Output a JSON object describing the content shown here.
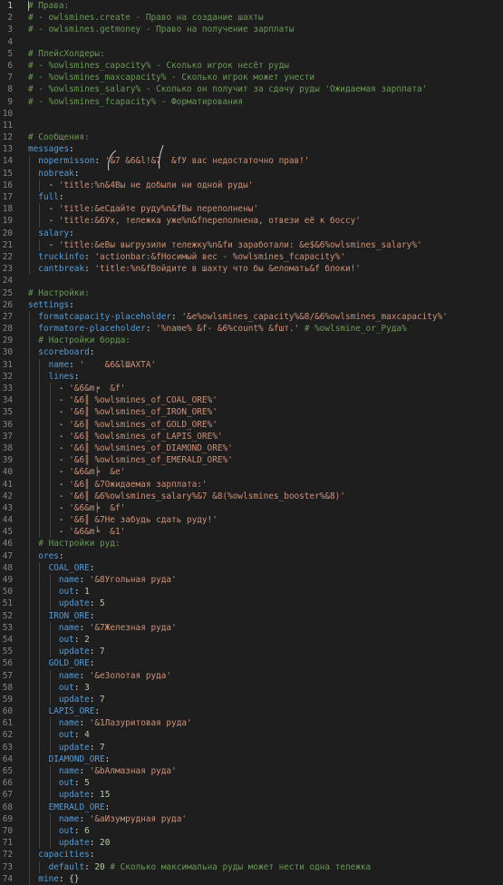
{
  "editor": {
    "lines": [
      {
        "n": "1",
        "t": [
          [
            "c",
            "# Права:"
          ]
        ]
      },
      {
        "n": "2",
        "t": [
          [
            "c",
            "# - owlsmines.create - Право на создание шахты"
          ]
        ]
      },
      {
        "n": "3",
        "t": [
          [
            "c",
            "# - owlsmines.getmoney - Право на получение зарплаты"
          ]
        ]
      },
      {
        "n": "4",
        "t": []
      },
      {
        "n": "5",
        "t": [
          [
            "c",
            "# ПлейсХолдеры:"
          ]
        ]
      },
      {
        "n": "6",
        "t": [
          [
            "c",
            "# - %owlsmines_capacity% - Сколько игрок несёт руды"
          ]
        ]
      },
      {
        "n": "7",
        "t": [
          [
            "c",
            "# - %owlsmines_maxcapacity% - Сколько игрок может унести"
          ]
        ]
      },
      {
        "n": "8",
        "t": [
          [
            "c",
            "# - %owlsmines_salary% - Сколько он получит за сдачу руды 'Ожидаемая зарплата'"
          ]
        ]
      },
      {
        "n": "9",
        "t": [
          [
            "c",
            "# - %owlsmines_fcapacity% - Форматирования"
          ]
        ]
      },
      {
        "n": "10",
        "t": []
      },
      {
        "n": "11",
        "t": []
      },
      {
        "n": "12",
        "t": [
          [
            "c",
            "# Сообщения:"
          ]
        ]
      },
      {
        "n": "13",
        "t": [
          [
            "k",
            "messages"
          ],
          [
            "p",
            ":"
          ]
        ]
      },
      {
        "n": "14",
        "t": [
          [
            "p",
            "  "
          ],
          [
            "k",
            "nopermisson"
          ],
          [
            "p",
            ": "
          ],
          [
            "s",
            "'&7 &6&l!&7  &fУ вас недостаточно прав!'"
          ]
        ]
      },
      {
        "n": "15",
        "t": [
          [
            "p",
            "  "
          ],
          [
            "k",
            "nobreak"
          ],
          [
            "p",
            ":"
          ]
        ]
      },
      {
        "n": "16",
        "t": [
          [
            "p",
            "    - "
          ],
          [
            "s",
            "'title:%n&4Вы не добыли ни одной руды'"
          ]
        ]
      },
      {
        "n": "17",
        "t": [
          [
            "p",
            "  "
          ],
          [
            "k",
            "full"
          ],
          [
            "p",
            ":"
          ]
        ]
      },
      {
        "n": "18",
        "t": [
          [
            "p",
            "    - "
          ],
          [
            "s",
            "'title:&eСдайте руду%n&fВы переполнены'"
          ]
        ]
      },
      {
        "n": "19",
        "t": [
          [
            "p",
            "    - "
          ],
          [
            "s",
            "'title:&6Ух, тележка уже%n&fпереполнена, отвези её к боссу'"
          ]
        ]
      },
      {
        "n": "20",
        "t": [
          [
            "p",
            "  "
          ],
          [
            "k",
            "salary"
          ],
          [
            "p",
            ":"
          ]
        ]
      },
      {
        "n": "21",
        "t": [
          [
            "p",
            "    - "
          ],
          [
            "s",
            "'title:&eВы выгрузили тележку%n&fи заработали: &e$&6%owlsmines_salary%'"
          ]
        ]
      },
      {
        "n": "22",
        "t": [
          [
            "p",
            "  "
          ],
          [
            "k",
            "truckinfo"
          ],
          [
            "p",
            ": "
          ],
          [
            "s",
            "'actionbar:&fНосимый вес - %owlsmines_fcapacity%'"
          ]
        ]
      },
      {
        "n": "23",
        "t": [
          [
            "p",
            "  "
          ],
          [
            "k",
            "cantbreak"
          ],
          [
            "p",
            ": "
          ],
          [
            "s",
            "'title:%n&fВойдите в шахту что бы &eломать&f блоки!'"
          ]
        ]
      },
      {
        "n": "24",
        "t": []
      },
      {
        "n": "25",
        "t": [
          [
            "c",
            "# Настройки:"
          ]
        ]
      },
      {
        "n": "26",
        "t": [
          [
            "k",
            "settings"
          ],
          [
            "p",
            ":"
          ]
        ]
      },
      {
        "n": "27",
        "t": [
          [
            "p",
            "  "
          ],
          [
            "k",
            "formatcapacity-placeholder"
          ],
          [
            "p",
            ": "
          ],
          [
            "s",
            "'&e%owlsmines_capacity%&8/&6%owlsmines_maxcapacity%'"
          ]
        ]
      },
      {
        "n": "28",
        "t": [
          [
            "p",
            "  "
          ],
          [
            "k",
            "formatore-placeholder"
          ],
          [
            "p",
            ": "
          ],
          [
            "s",
            "'%name% &f- &6%count% &fшт.'"
          ],
          [
            "p",
            " "
          ],
          [
            "c",
            "# %owlsmine_or_Руда%"
          ]
        ]
      },
      {
        "n": "29",
        "t": [
          [
            "p",
            "  "
          ],
          [
            "c",
            "# Настройки борда:"
          ]
        ]
      },
      {
        "n": "30",
        "t": [
          [
            "p",
            "  "
          ],
          [
            "k",
            "scoreboard"
          ],
          [
            "p",
            ":"
          ]
        ]
      },
      {
        "n": "31",
        "t": [
          [
            "p",
            "    "
          ],
          [
            "k",
            "name"
          ],
          [
            "p",
            ": "
          ],
          [
            "s",
            "'    &6&lШАХТА'"
          ]
        ]
      },
      {
        "n": "32",
        "t": [
          [
            "p",
            "    "
          ],
          [
            "k",
            "lines"
          ],
          [
            "p",
            ":"
          ]
        ]
      },
      {
        "n": "33",
        "t": [
          [
            "p",
            "      - "
          ],
          [
            "s",
            "'&6&m╒  &f'"
          ]
        ]
      },
      {
        "n": "34",
        "t": [
          [
            "p",
            "      - "
          ],
          [
            "s",
            "'&6║ %owlsmines_of_COAL_ORE%'"
          ]
        ]
      },
      {
        "n": "35",
        "t": [
          [
            "p",
            "      - "
          ],
          [
            "s",
            "'&6║ %owlsmines_of_IRON_ORE%'"
          ]
        ]
      },
      {
        "n": "36",
        "t": [
          [
            "p",
            "      - "
          ],
          [
            "s",
            "'&6║ %owlsmines_of_GOLD_ORE%'"
          ]
        ]
      },
      {
        "n": "37",
        "t": [
          [
            "p",
            "      - "
          ],
          [
            "s",
            "'&6║ %owlsmines_of_LAPIS_ORE%'"
          ]
        ]
      },
      {
        "n": "38",
        "t": [
          [
            "p",
            "      - "
          ],
          [
            "s",
            "'&6║ %owlsmines_of_DIAMOND_ORE%'"
          ]
        ]
      },
      {
        "n": "39",
        "t": [
          [
            "p",
            "      - "
          ],
          [
            "s",
            "'&6║ %owlsmines_of_EMERALD_ORE%'"
          ]
        ]
      },
      {
        "n": "40",
        "t": [
          [
            "p",
            "      - "
          ],
          [
            "s",
            "'&6&m╞  &e'"
          ]
        ]
      },
      {
        "n": "41",
        "t": [
          [
            "p",
            "      - "
          ],
          [
            "s",
            "'&6║ &7Ожидаемая зарплата:'"
          ]
        ]
      },
      {
        "n": "42",
        "t": [
          [
            "p",
            "      - "
          ],
          [
            "s",
            "'&6║ &6%owlsmines_salary%&7 &8(%owlsmines_booster%&8)'"
          ]
        ]
      },
      {
        "n": "43",
        "t": [
          [
            "p",
            "      - "
          ],
          [
            "s",
            "'&6&m╞  &f'"
          ]
        ]
      },
      {
        "n": "44",
        "t": [
          [
            "p",
            "      - "
          ],
          [
            "s",
            "'&6║ &7Не забудь сдать руду!'"
          ]
        ]
      },
      {
        "n": "45",
        "t": [
          [
            "p",
            "      - "
          ],
          [
            "s",
            "'&6&m╘  &1'"
          ]
        ]
      },
      {
        "n": "46",
        "t": [
          [
            "p",
            "  "
          ],
          [
            "c",
            "# Настройки руд:"
          ]
        ]
      },
      {
        "n": "47",
        "t": [
          [
            "p",
            "  "
          ],
          [
            "k",
            "ores"
          ],
          [
            "p",
            ":"
          ]
        ]
      },
      {
        "n": "48",
        "t": [
          [
            "p",
            "    "
          ],
          [
            "k",
            "COAL_ORE"
          ],
          [
            "p",
            ":"
          ]
        ]
      },
      {
        "n": "49",
        "t": [
          [
            "p",
            "      "
          ],
          [
            "k",
            "name"
          ],
          [
            "p",
            ": "
          ],
          [
            "s",
            "'&8Угольная руда'"
          ]
        ]
      },
      {
        "n": "50",
        "t": [
          [
            "p",
            "      "
          ],
          [
            "k",
            "out"
          ],
          [
            "p",
            ": "
          ],
          [
            "n",
            "1"
          ]
        ]
      },
      {
        "n": "51",
        "t": [
          [
            "p",
            "      "
          ],
          [
            "k",
            "update"
          ],
          [
            "p",
            ": "
          ],
          [
            "n",
            "5"
          ]
        ]
      },
      {
        "n": "52",
        "t": [
          [
            "p",
            "    "
          ],
          [
            "k",
            "IRON_ORE"
          ],
          [
            "p",
            ":"
          ]
        ]
      },
      {
        "n": "53",
        "t": [
          [
            "p",
            "      "
          ],
          [
            "k",
            "name"
          ],
          [
            "p",
            ": "
          ],
          [
            "s",
            "'&7Железная руда'"
          ]
        ]
      },
      {
        "n": "54",
        "t": [
          [
            "p",
            "      "
          ],
          [
            "k",
            "out"
          ],
          [
            "p",
            ": "
          ],
          [
            "n",
            "2"
          ]
        ]
      },
      {
        "n": "55",
        "t": [
          [
            "p",
            "      "
          ],
          [
            "k",
            "update"
          ],
          [
            "p",
            ": "
          ],
          [
            "n",
            "7"
          ]
        ]
      },
      {
        "n": "56",
        "t": [
          [
            "p",
            "    "
          ],
          [
            "k",
            "GOLD_ORE"
          ],
          [
            "p",
            ":"
          ]
        ]
      },
      {
        "n": "57",
        "t": [
          [
            "p",
            "      "
          ],
          [
            "k",
            "name"
          ],
          [
            "p",
            ": "
          ],
          [
            "s",
            "'&eЗолотая руда'"
          ]
        ]
      },
      {
        "n": "58",
        "t": [
          [
            "p",
            "      "
          ],
          [
            "k",
            "out"
          ],
          [
            "p",
            ": "
          ],
          [
            "n",
            "3"
          ]
        ]
      },
      {
        "n": "59",
        "t": [
          [
            "p",
            "      "
          ],
          [
            "k",
            "update"
          ],
          [
            "p",
            ": "
          ],
          [
            "n",
            "7"
          ]
        ]
      },
      {
        "n": "60",
        "t": [
          [
            "p",
            "    "
          ],
          [
            "k",
            "LAPIS_ORE"
          ],
          [
            "p",
            ":"
          ]
        ]
      },
      {
        "n": "61",
        "t": [
          [
            "p",
            "      "
          ],
          [
            "k",
            "name"
          ],
          [
            "p",
            ": "
          ],
          [
            "s",
            "'&1Лазуритовая руда'"
          ]
        ]
      },
      {
        "n": "62",
        "t": [
          [
            "p",
            "      "
          ],
          [
            "k",
            "out"
          ],
          [
            "p",
            ": "
          ],
          [
            "n",
            "4"
          ]
        ]
      },
      {
        "n": "63",
        "t": [
          [
            "p",
            "      "
          ],
          [
            "k",
            "update"
          ],
          [
            "p",
            ": "
          ],
          [
            "n",
            "7"
          ]
        ]
      },
      {
        "n": "64",
        "t": [
          [
            "p",
            "    "
          ],
          [
            "k",
            "DIAMOND_ORE"
          ],
          [
            "p",
            ":"
          ]
        ]
      },
      {
        "n": "65",
        "t": [
          [
            "p",
            "      "
          ],
          [
            "k",
            "name"
          ],
          [
            "p",
            ": "
          ],
          [
            "s",
            "'&bАлмазная руда'"
          ]
        ]
      },
      {
        "n": "66",
        "t": [
          [
            "p",
            "      "
          ],
          [
            "k",
            "out"
          ],
          [
            "p",
            ": "
          ],
          [
            "n",
            "5"
          ]
        ]
      },
      {
        "n": "67",
        "t": [
          [
            "p",
            "      "
          ],
          [
            "k",
            "update"
          ],
          [
            "p",
            ": "
          ],
          [
            "n",
            "15"
          ]
        ]
      },
      {
        "n": "68",
        "t": [
          [
            "p",
            "    "
          ],
          [
            "k",
            "EMERALD_ORE"
          ],
          [
            "p",
            ":"
          ]
        ]
      },
      {
        "n": "69",
        "t": [
          [
            "p",
            "      "
          ],
          [
            "k",
            "name"
          ],
          [
            "p",
            ": "
          ],
          [
            "s",
            "'&aИзумрудная руда'"
          ]
        ]
      },
      {
        "n": "70",
        "t": [
          [
            "p",
            "      "
          ],
          [
            "k",
            "out"
          ],
          [
            "p",
            ": "
          ],
          [
            "n",
            "6"
          ]
        ]
      },
      {
        "n": "71",
        "t": [
          [
            "p",
            "      "
          ],
          [
            "k",
            "update"
          ],
          [
            "p",
            ": "
          ],
          [
            "n",
            "20"
          ]
        ]
      },
      {
        "n": "72",
        "t": [
          [
            "p",
            "  "
          ],
          [
            "k",
            "capacities"
          ],
          [
            "p",
            ":"
          ]
        ]
      },
      {
        "n": "73",
        "t": [
          [
            "p",
            "    "
          ],
          [
            "k",
            "default"
          ],
          [
            "p",
            ": "
          ],
          [
            "n",
            "20"
          ],
          [
            "p",
            " "
          ],
          [
            "c",
            "# Сколько максимальна руды может нести одна тележка"
          ]
        ]
      },
      {
        "n": "74",
        "t": [
          [
            "p",
            "  "
          ],
          [
            "k",
            "mine"
          ],
          [
            "p",
            ": "
          ],
          [
            "p",
            "{}"
          ]
        ]
      }
    ]
  },
  "colors": {
    "background": "#1e1e1e",
    "key": "#569cd6",
    "comment": "#6a9955",
    "string": "#ce9178",
    "number": "#b5cea8",
    "gutter": "#858585"
  }
}
